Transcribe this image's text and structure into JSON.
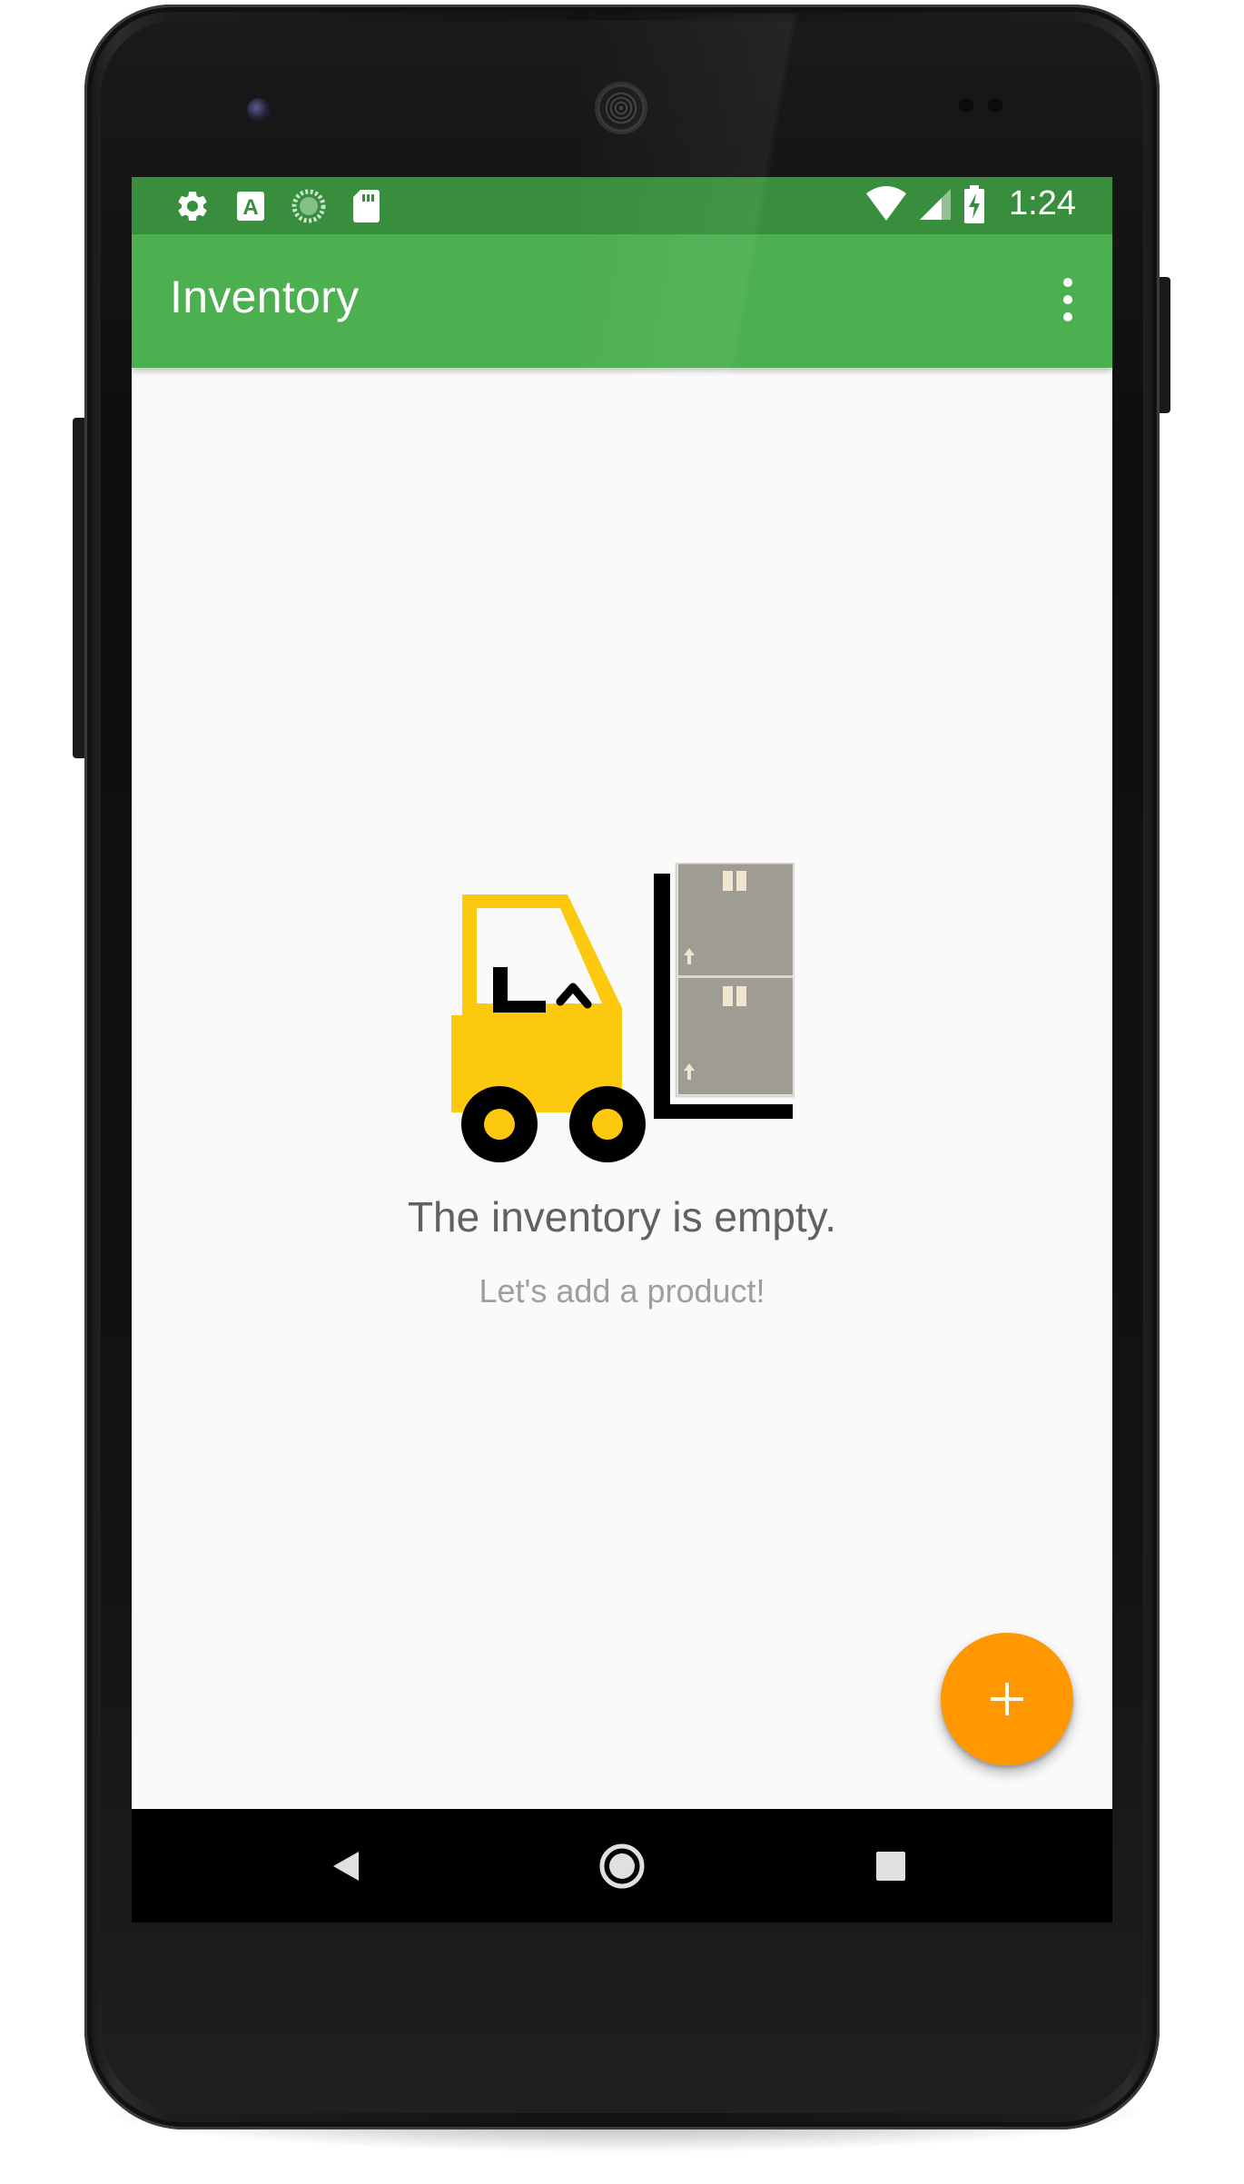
{
  "status_bar": {
    "time": "1:24",
    "left_icons": [
      "gear-icon",
      "a-badge-icon",
      "sync-progress-icon",
      "sd-card-icon"
    ],
    "right_icons": [
      "wifi-icon",
      "signal-icon",
      "battery-charging-icon"
    ]
  },
  "app_bar": {
    "title": "Inventory",
    "overflow_icon": "more-vert-icon"
  },
  "empty_state": {
    "illustration_icon": "forklift-icon",
    "title": "The inventory is empty.",
    "subtitle": "Let's add a product!"
  },
  "fab": {
    "icon": "plus-icon",
    "color": "#ff9800"
  },
  "nav_bar": {
    "icons": [
      "back-icon",
      "home-icon",
      "recents-icon"
    ]
  },
  "colors": {
    "status_bar": "#388e3c",
    "app_bar": "#4caf50",
    "background": "#fafafa",
    "accent": "#ff9800",
    "forklift_body": "#fdc90f",
    "boxes": "#9e9c93"
  }
}
